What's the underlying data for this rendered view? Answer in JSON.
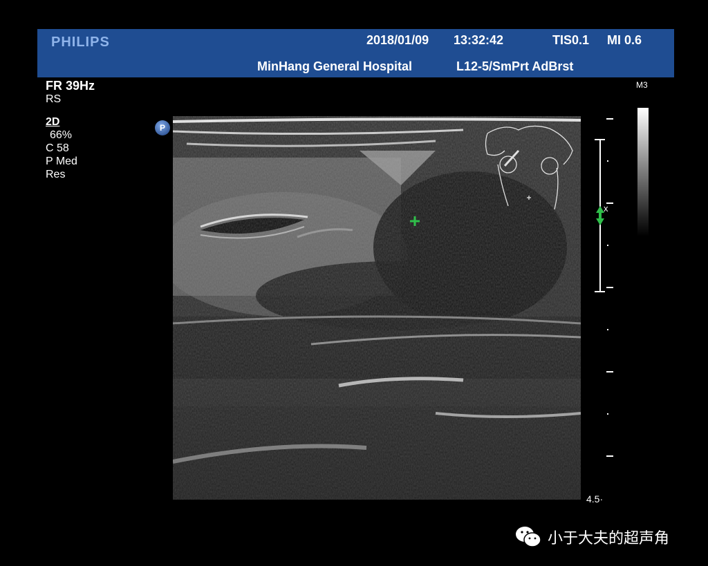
{
  "banner": {
    "brand": "PHILIPS",
    "date": "2018/01/09",
    "time": "13:32:42",
    "tis": "TIS0.1",
    "mi": "MI 0.6",
    "hospital": "MinHang General Hospital",
    "probe": "L12-5/SmPrt AdBrst"
  },
  "params": {
    "fr": "FR 39Hz",
    "rs": "RS",
    "mode": "2D",
    "gain": "66%",
    "compression": "C 58",
    "power": "P Med",
    "res": "Res"
  },
  "colormap_label": "M3",
  "marker_label": "P",
  "scale": {
    "focus_label": "x",
    "depth": "4.5"
  },
  "footer": {
    "channel": "小于大夫的超声角"
  },
  "colors": {
    "banner": "#1f4d92",
    "brand": "#8fb4ea",
    "caliper": "#2fbf4a"
  },
  "icons": [
    "p-marker-icon",
    "wechat-icon",
    "body-marker-icon",
    "focus-arrow-icon"
  ]
}
